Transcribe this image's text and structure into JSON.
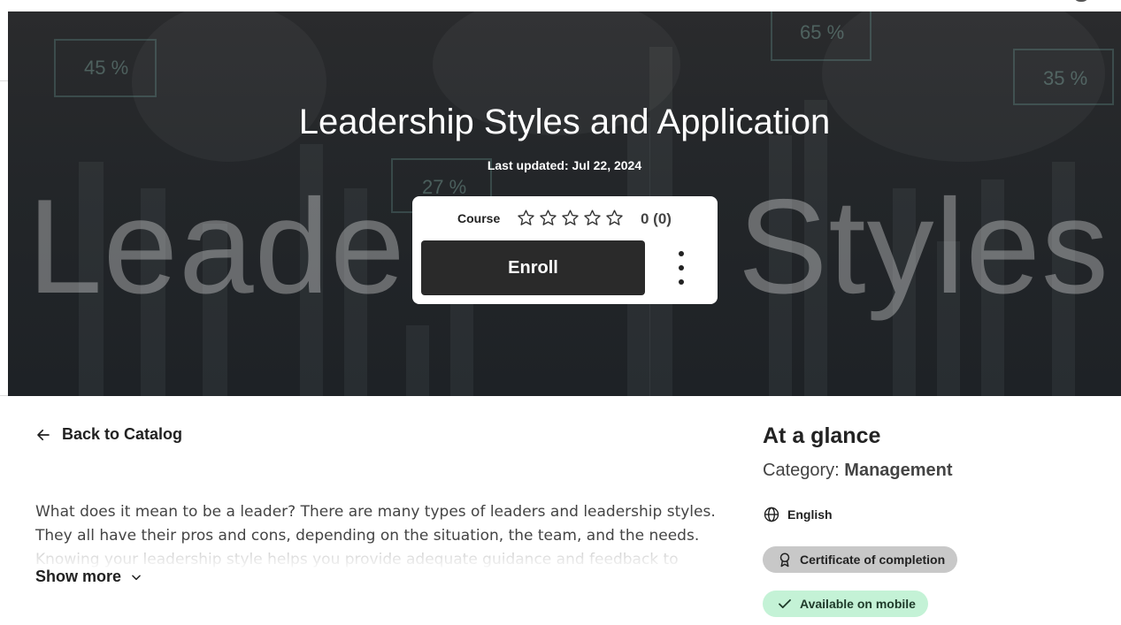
{
  "course": {
    "title": "Leadership Styles and Application",
    "last_updated": "Last updated: Jul 22, 2024",
    "banner_word_left": "Leader",
    "banner_word_right": "Styles",
    "banner_percents": [
      "45 %",
      "65 %",
      "35 %",
      "27 %"
    ]
  },
  "card": {
    "type_label": "Course",
    "rating_text": "0 (0)",
    "stars_filled": 0,
    "stars_total": 5,
    "enroll_label": "Enroll"
  },
  "nav": {
    "back_label": "Back to Catalog"
  },
  "description": {
    "text": "What does it mean to be a leader? There are many types of leaders and leadership styles. They all have their pros and cons, depending on the situation, the team, and the needs.",
    "faded_line": "Knowing your leadership style helps you provide adequate guidance and feedback to employees",
    "show_more_label": "Show more"
  },
  "glance": {
    "title": "At a glance",
    "category_label": "Category:",
    "category_value": "Management",
    "language": "English",
    "certificate_label": "Certificate of completion",
    "mobile_label": "Available on mobile"
  },
  "colors": {
    "enroll_bg": "#2a2a2a",
    "mobile_pill": "#c4f2d6",
    "certificate_pill": "#c8c8c8"
  }
}
